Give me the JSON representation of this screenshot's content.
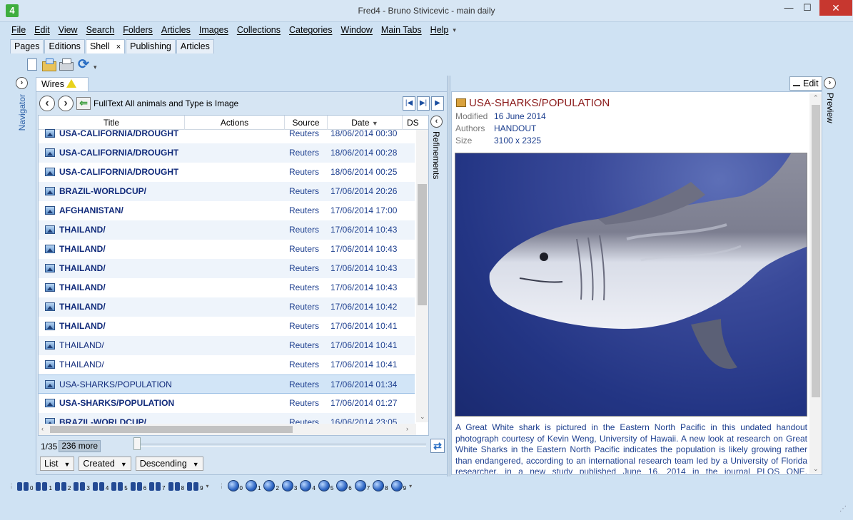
{
  "window": {
    "title": "Fred4 - Bruno Stivicevic - main daily",
    "app_icon": "4",
    "minimize": "—",
    "maximize": "☐",
    "close": "✕"
  },
  "menu": [
    "File",
    "Edit",
    "View",
    "Search",
    "Folders",
    "Articles",
    "Images",
    "Collections",
    "Categories",
    "Window",
    "Main Tabs",
    "Help"
  ],
  "main_tabs": [
    {
      "label": "Pages"
    },
    {
      "label": "Editions"
    },
    {
      "label": "Shell",
      "active": true,
      "close": "×"
    },
    {
      "label": "Publishing"
    },
    {
      "label": "Articles"
    }
  ],
  "toolbar": [
    "new-document-icon",
    "open-folder-icon",
    "print-icon",
    "refresh-icon"
  ],
  "navigator": {
    "label": "Navigator",
    "toggle": "›"
  },
  "wires": {
    "tab_label": "Wires",
    "tab_close": "×",
    "query": "FullText All animals and Type is Image",
    "back": "‹",
    "forward": "›",
    "columns": [
      "Title",
      "Actions",
      "Source",
      "Date",
      "DS"
    ],
    "sort_indicator": "▼",
    "rows": [
      {
        "title": "USA-CALIFORNIA/DROUGHT",
        "source": "Reuters",
        "date": "18/06/2014 00:30",
        "bold": true
      },
      {
        "title": "USA-CALIFORNIA/DROUGHT",
        "source": "Reuters",
        "date": "18/06/2014 00:28",
        "bold": true
      },
      {
        "title": "USA-CALIFORNIA/DROUGHT",
        "source": "Reuters",
        "date": "18/06/2014 00:25",
        "bold": true
      },
      {
        "title": "BRAZIL-WORLDCUP/",
        "source": "Reuters",
        "date": "17/06/2014 20:26",
        "bold": true
      },
      {
        "title": "AFGHANISTAN/",
        "source": "Reuters",
        "date": "17/06/2014 17:00",
        "bold": true
      },
      {
        "title": "THAILAND/",
        "source": "Reuters",
        "date": "17/06/2014 10:43",
        "bold": true
      },
      {
        "title": "THAILAND/",
        "source": "Reuters",
        "date": "17/06/2014 10:43",
        "bold": true
      },
      {
        "title": "THAILAND/",
        "source": "Reuters",
        "date": "17/06/2014 10:43",
        "bold": true
      },
      {
        "title": "THAILAND/",
        "source": "Reuters",
        "date": "17/06/2014 10:43",
        "bold": true
      },
      {
        "title": "THAILAND/",
        "source": "Reuters",
        "date": "17/06/2014 10:42",
        "bold": true
      },
      {
        "title": "THAILAND/",
        "source": "Reuters",
        "date": "17/06/2014 10:41",
        "bold": true
      },
      {
        "title": "THAILAND/",
        "source": "Reuters",
        "date": "17/06/2014 10:41",
        "bold": false
      },
      {
        "title": "THAILAND/",
        "source": "Reuters",
        "date": "17/06/2014 10:41",
        "bold": false
      },
      {
        "title": "USA-SHARKS/POPULATION",
        "source": "Reuters",
        "date": "17/06/2014 01:34",
        "bold": false,
        "selected": true
      },
      {
        "title": "USA-SHARKS/POPULATION",
        "source": "Reuters",
        "date": "17/06/2014 01:27",
        "bold": true
      },
      {
        "title": "BRAZIL-WORLDCUP/",
        "source": "Reuters",
        "date": "16/06/2014 23:05",
        "bold": true
      }
    ],
    "count": "1/35",
    "more": "236 more",
    "view_mode": "List",
    "sort_field": "Created",
    "sort_order": "Descending",
    "refinements_label": "Refinements",
    "refinements_toggle": "‹"
  },
  "preview": {
    "edit_label": "Edit",
    "label": "Preview",
    "toggle": "›",
    "title": "USA-SHARKS/POPULATION",
    "meta": [
      {
        "key": "Modified",
        "value": "16 June 2014"
      },
      {
        "key": "Authors",
        "value": "HANDOUT"
      },
      {
        "key": "Size",
        "value": "3100 x 2325"
      }
    ],
    "caption": "A Great White shark is pictured in the Eastern North Pacific in this undated handout photograph courtesy of Kevin Weng, University of Hawaii. A new look at research on Great White Sharks in the Eastern North Pacific indicates the population is likely growing rather than endangered, according to an international research team led by a University of Florida researcher, in a new study published June 16, 2014 in the journal PLOS ONE. REUTERS/Kevin"
  },
  "bottom_bar": {
    "search_slots": [
      "0",
      "1",
      "2",
      "3",
      "4",
      "5",
      "6",
      "7",
      "8",
      "9"
    ],
    "globe_slots": [
      "0",
      "1",
      "2",
      "3",
      "4",
      "5",
      "6",
      "7",
      "8",
      "9"
    ]
  }
}
